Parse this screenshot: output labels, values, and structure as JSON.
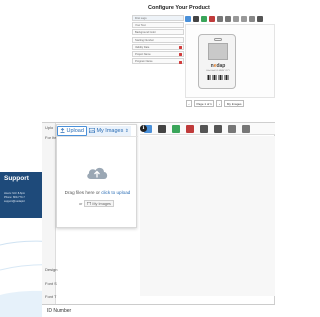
{
  "configure": {
    "title": "Configure Your Product",
    "fields": [
      {
        "label": "First Logo",
        "deletable": false
      },
      {
        "label": "Your Text",
        "deletable": false
      },
      {
        "label": "Background Color",
        "deletable": false
      },
      {
        "label": "Starting Number",
        "deletable": false
      },
      {
        "label": "Validity Date",
        "deletable": true
      },
      {
        "label": "Project Name",
        "deletable": true
      },
      {
        "label": "Program Name",
        "deletable": true
      }
    ],
    "tag_logo_prefix": "n",
    "tag_logo_accent": "e",
    "tag_logo_suffix": "dap",
    "tag_subtitle": "Valid Until DD MMM YYYY",
    "pager": {
      "page_text": "Page 1 of 1",
      "my_images": "My Images"
    }
  },
  "support": {
    "title": "Support",
    "lines": [
      "Hours: M-F 8-6pm",
      "Phone: 800-770-7",
      "support@nedapid"
    ]
  },
  "panel": {
    "strip_top_label": "Uplo",
    "strip_labels": [
      "For Ite",
      "Design",
      "Font S",
      "Font T"
    ],
    "footer_label": "ID Number"
  },
  "upload_popup": {
    "tab_upload": "Upload",
    "tab_myimages": "My Images",
    "info_symbol": "i",
    "drop_text_prefix": "Drag files here or ",
    "drop_text_link": "click to upload",
    "or_label": "or",
    "my_images_button": "My Images"
  },
  "colors": {
    "accent_blue": "#2a6db5",
    "support_bg": "#1e4a7a",
    "delete_red": "#d23b3b",
    "logo_orange": "#e8822b",
    "cloud_gray": "#9aa7b4"
  }
}
